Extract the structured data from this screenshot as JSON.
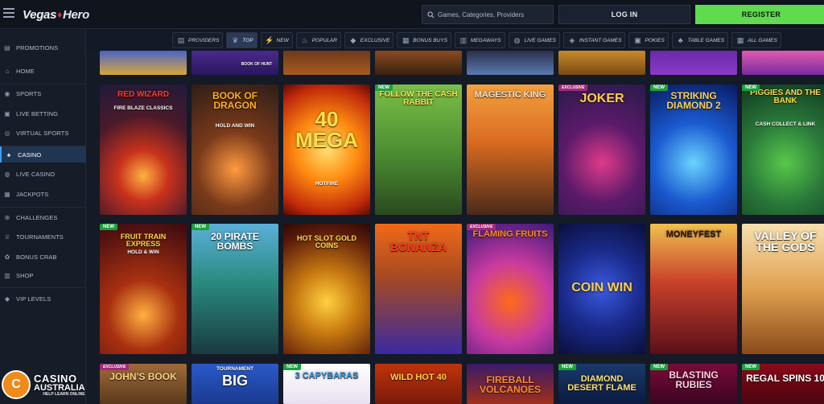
{
  "header": {
    "logo_left": "Vegas",
    "logo_right": "Hero",
    "search_placeholder": "Games, Categories, Providers",
    "login_label": "LOG IN",
    "register_label": "REGISTER"
  },
  "colors": {
    "accent_green": "#5edc4e",
    "active_blue": "#3aa0ff",
    "background": "#141a26"
  },
  "sidebar": {
    "items": [
      {
        "label": "PROMOTIONS",
        "icon": "gift-icon",
        "glyph": "▤"
      },
      {
        "label": "HOME",
        "icon": "home-icon",
        "glyph": "⌂"
      },
      {
        "label": "SPORTS",
        "icon": "ball-icon",
        "glyph": "◉"
      },
      {
        "label": "LIVE BETTING",
        "icon": "live-icon",
        "glyph": "▣"
      },
      {
        "label": "VIRTUAL SPORTS",
        "icon": "virtual-icon",
        "glyph": "◎"
      },
      {
        "label": "CASINO",
        "icon": "cards-icon",
        "glyph": "♠"
      },
      {
        "label": "LIVE CASINO",
        "icon": "chip-icon",
        "glyph": "◍"
      },
      {
        "label": "JACKPOTS",
        "icon": "jackpot-icon",
        "glyph": "▦"
      },
      {
        "label": "CHALLENGES",
        "icon": "target-icon",
        "glyph": "⊕"
      },
      {
        "label": "TOURNAMENTS",
        "icon": "trophy-icon",
        "glyph": "♕"
      },
      {
        "label": "BONUS CRAB",
        "icon": "crab-icon",
        "glyph": "✿"
      },
      {
        "label": "SHOP",
        "icon": "shop-icon",
        "glyph": "▥"
      },
      {
        "label": "VIP LEVELS",
        "icon": "diamond-icon",
        "glyph": "◆"
      }
    ]
  },
  "categories": [
    {
      "label": "PROVIDERS",
      "icon": "providers-icon",
      "glyph": "▤"
    },
    {
      "label": "TOP",
      "icon": "crown-icon",
      "glyph": "♛"
    },
    {
      "label": "NEW",
      "icon": "bolt-icon",
      "glyph": "⚡"
    },
    {
      "label": "POPULAR",
      "icon": "flame-icon",
      "glyph": "♨"
    },
    {
      "label": "EXCLUSIVE",
      "icon": "gem-icon",
      "glyph": "◆"
    },
    {
      "label": "BONUS BUYS",
      "icon": "buy-icon",
      "glyph": "▦"
    },
    {
      "label": "MEGAWAYS",
      "icon": "megaways-icon",
      "glyph": "▥"
    },
    {
      "label": "LIVE GAMES",
      "icon": "live-games-icon",
      "glyph": "◍"
    },
    {
      "label": "INSTANT GAMES",
      "icon": "gamepad-icon",
      "glyph": "◈"
    },
    {
      "label": "POKIES",
      "icon": "pokies-icon",
      "glyph": "▣"
    },
    {
      "label": "TABLE GAMES",
      "icon": "table-icon",
      "glyph": "♣"
    },
    {
      "label": "ALL GAMES",
      "icon": "grid-icon",
      "glyph": "▦"
    }
  ],
  "games": {
    "row0": [
      "",
      "BOOK OF HUNT",
      "",
      "",
      "",
      "",
      "",
      ""
    ],
    "row1": [
      {
        "title": "RED WIZARD",
        "sub": "FIRE BLAZE CLASSICS",
        "badge": ""
      },
      {
        "title": "BOOK OF DRAGON",
        "sub": "HOLD AND WIN",
        "badge": ""
      },
      {
        "title": "40 MEGA",
        "sub": "HOTFIRE",
        "badge": ""
      },
      {
        "title": "FOLLOW THE CASH RABBIT",
        "sub": "",
        "badge": "NEW"
      },
      {
        "title": "MAGESTIC KING",
        "sub": "",
        "badge": ""
      },
      {
        "title": "JOKER",
        "sub": "",
        "badge": "EXCLUSIVE"
      },
      {
        "title": "STRIKING DIAMOND 2",
        "sub": "",
        "badge": "NEW"
      },
      {
        "title": "PIGGIES AND THE BANK",
        "sub": "CASH COLLECT & LINK",
        "badge": "NEW"
      }
    ],
    "row2": [
      {
        "title": "FRUIT TRAIN EXPRESS",
        "sub": "HOLD & WIN",
        "badge": "NEW"
      },
      {
        "title": "20 PIRATE BOMBS",
        "sub": "",
        "badge": "NEW"
      },
      {
        "title": "HOT SLOT GOLD COINS",
        "sub": "",
        "badge": ""
      },
      {
        "title": "TNT BONANZA",
        "sub": "",
        "badge": ""
      },
      {
        "title": "FLAMING FRUITS",
        "sub": "",
        "badge": "EXCLUSIVE"
      },
      {
        "title": "COIN WIN",
        "sub": "",
        "badge": ""
      },
      {
        "title": "MONEYFEST",
        "sub": "",
        "badge": ""
      },
      {
        "title": "VALLEY OF THE GODS",
        "sub": "",
        "badge": ""
      }
    ],
    "row3": [
      {
        "title": "JOHN'S BOOK",
        "sub": "",
        "badge": "EXCLUSIVE"
      },
      {
        "title": "BIG",
        "sub": "TOURNAMENT",
        "badge": ""
      },
      {
        "title": "3 CAPYBARAS",
        "sub": "",
        "badge": "NEW"
      },
      {
        "title": "WILD HOT 40",
        "sub": "",
        "badge": ""
      },
      {
        "title": "FIREBALL VOLCANOES",
        "sub": "",
        "badge": ""
      },
      {
        "title": "DIAMOND DESERT FLAME",
        "sub": "",
        "badge": "NEW"
      },
      {
        "title": "BLASTING RUBIES",
        "sub": "",
        "badge": "NEW"
      },
      {
        "title": "REGAL SPINS 10",
        "sub": "",
        "badge": "NEW"
      }
    ]
  },
  "watermark": {
    "line1": "CASINO",
    "line2": "AUSTRALIA",
    "line3": "HELP LEARN ONLINE",
    "mark": "C"
  }
}
